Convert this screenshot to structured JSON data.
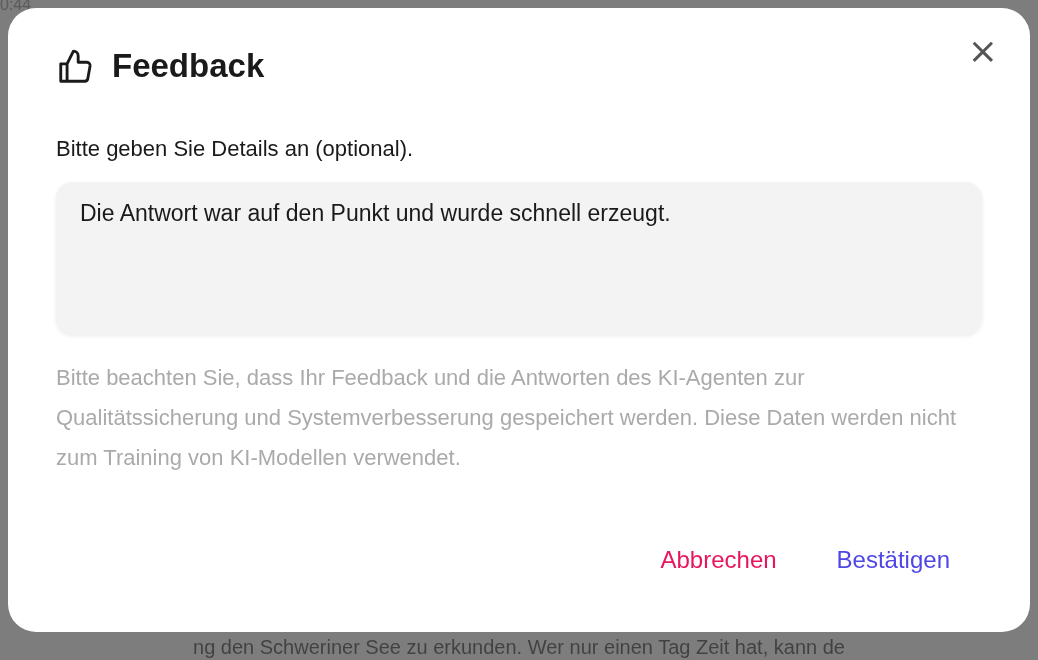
{
  "background": {
    "time": "0:44",
    "text_line": "ng den Schweriner See zu erkunden. Wer nur einen Tag Zeit hat, kann de"
  },
  "dialog": {
    "title": "Feedback",
    "close": "×",
    "field_label": "Bitte geben Sie Details an (optional).",
    "field_value": "Die Antwort war auf den Punkt und wurde schnell erzeugt.",
    "note": "Bitte beachten Sie, dass Ihr Feedback und die Antworten des KI-Agenten zur Qualitätssicherung und Systemverbesserung gespeichert werden. Diese Daten werden nicht zum Training von KI-Modellen verwendet.",
    "buttons": [
      {
        "label": "Abbrechen",
        "kind": "cancel"
      },
      {
        "label": "Bestätigen",
        "kind": "confirm"
      }
    ]
  }
}
